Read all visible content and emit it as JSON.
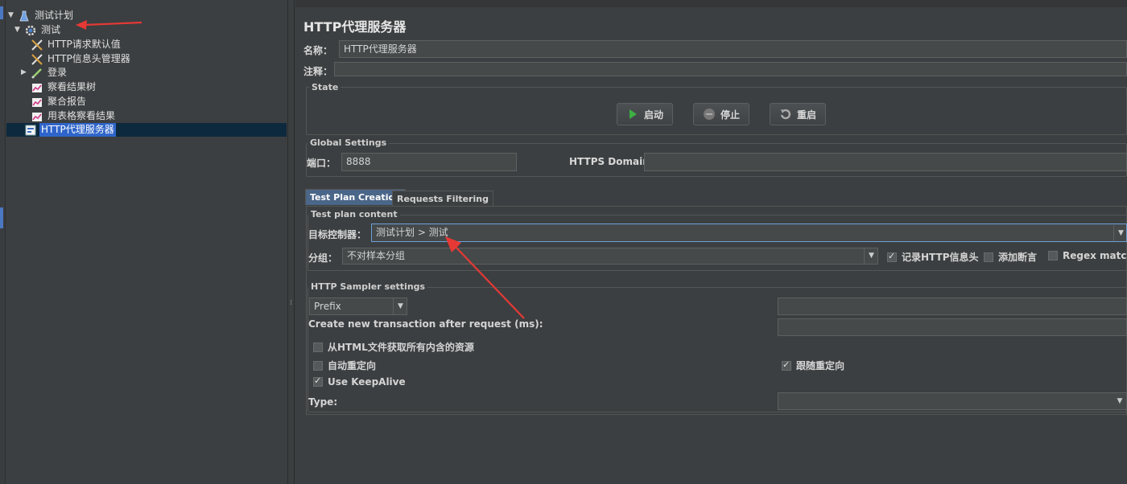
{
  "tree": {
    "items": [
      {
        "label": "测试计划",
        "icon": "test-plan-icon",
        "expanded": true
      },
      {
        "label": "测试",
        "icon": "thread-group-gear-icon",
        "expanded": true
      },
      {
        "label": "HTTP请求默认值",
        "icon": "config-wrench-icon"
      },
      {
        "label": "HTTP信息头管理器",
        "icon": "config-wrench-icon"
      },
      {
        "label": "登录",
        "icon": "sampler-pipette-icon",
        "expanded": false
      },
      {
        "label": "察看结果树",
        "icon": "listener-chart-icon"
      },
      {
        "label": "聚合报告",
        "icon": "listener-chart-icon"
      },
      {
        "label": "用表格察看结果",
        "icon": "listener-chart-icon"
      },
      {
        "label": "HTTP代理服务器",
        "icon": "proxy-server-icon",
        "selected": true
      }
    ]
  },
  "main": {
    "title": "HTTP代理服务器",
    "name_label": "名称：",
    "name_value": "HTTP代理服务器",
    "comment_label": "注释：",
    "comment_value": "",
    "state": {
      "title": "State",
      "start": "启动",
      "stop": "停止",
      "restart": "重启"
    },
    "global": {
      "title": "Global Settings",
      "port_label": "端口：",
      "port_value": "8888",
      "https_label": "HTTPS Domains:",
      "https_value": ""
    },
    "tabs": [
      {
        "label": "Test Plan Creation",
        "active": true
      },
      {
        "label": "Requests Filtering",
        "active": false
      }
    ],
    "content": {
      "title": "Test plan content",
      "target_label": "目标控制器：",
      "target_value": "测试计划 > 测试",
      "group_label": "分组：",
      "group_value": "不对样本分组",
      "record_headers": "记录HTTP信息头",
      "record_headers_checked": true,
      "add_assertions": "添加断言",
      "add_assertions_checked": false,
      "regex": "Regex matchin",
      "regex_checked": false
    },
    "sampler": {
      "title": "HTTP Sampler settings",
      "prefix_value": "Prefix",
      "prefix_input": "",
      "transaction_label": "Create new transaction after request (ms):",
      "transaction_value": "",
      "fetch_resources": "从HTML文件获取所有内含的资源",
      "fetch_resources_checked": false,
      "auto_redirect": "自动重定向",
      "auto_redirect_checked": false,
      "follow_redirects": "跟随重定向",
      "follow_redirects_checked": true,
      "keepalive": "Use KeepAlive",
      "keepalive_checked": true,
      "type_label": "Type:",
      "type_value": ""
    }
  },
  "colors": {
    "background": "#3c3f41",
    "selection": "#2f65ca",
    "active_tab": "#4a6688",
    "annotation_arrow": "#e53935"
  }
}
